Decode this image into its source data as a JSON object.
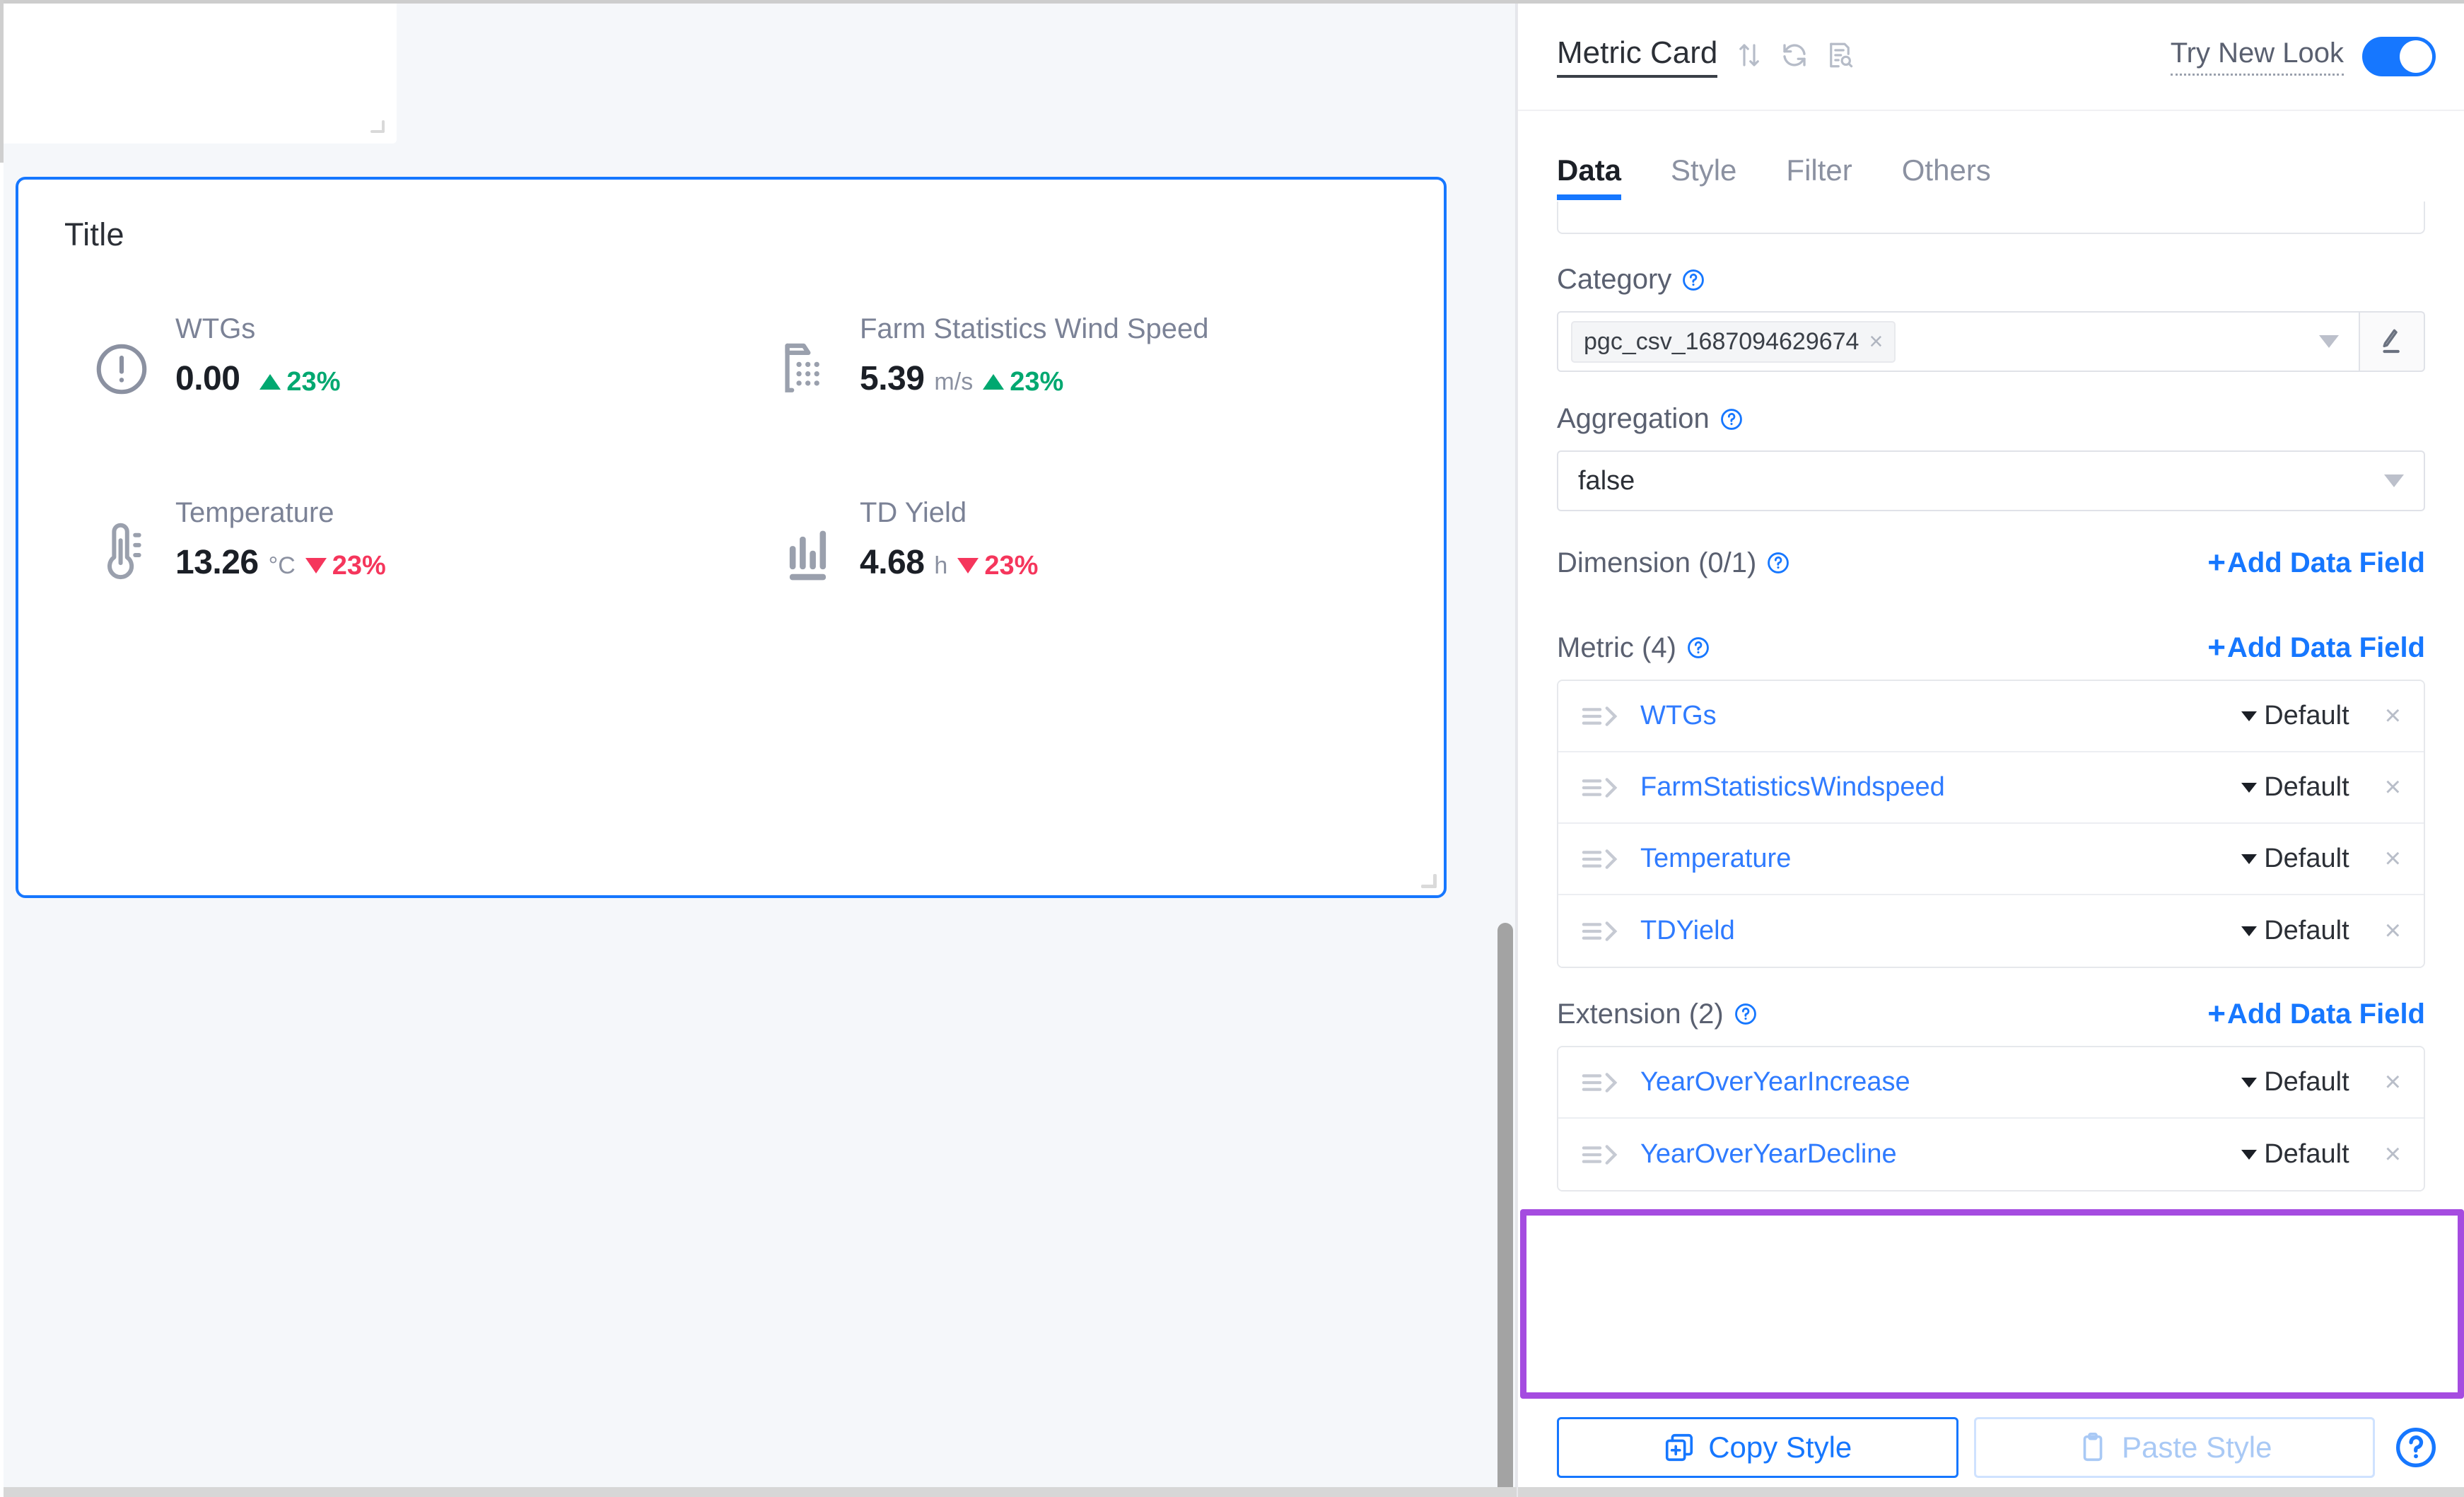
{
  "canvas": {
    "widget": {
      "title": "Title",
      "metrics": [
        {
          "icon": "alert-circle-icon",
          "label": "WTGs",
          "value": "0.00",
          "unit": "",
          "delta": "23%",
          "direction": "up"
        },
        {
          "icon": "data-file-icon",
          "label": "Farm Statistics Wind Speed",
          "value": "5.39",
          "unit": "m/s",
          "delta": "23%",
          "direction": "up"
        },
        {
          "icon": "thermometer-icon",
          "label": "Temperature",
          "value": "13.26",
          "unit": "°C",
          "delta": "23%",
          "direction": "down"
        },
        {
          "icon": "bar-chart-icon",
          "label": "TD Yield",
          "value": "4.68",
          "unit": "h",
          "delta": "23%",
          "direction": "down"
        }
      ]
    }
  },
  "panel": {
    "chart_type": "Metric Card",
    "header_icons": [
      "sort-icon",
      "refresh-icon",
      "inspect-data-icon"
    ],
    "try_new_look_label": "Try New Look",
    "try_new_look_enabled": true,
    "tabs": [
      {
        "label": "Data",
        "active": true
      },
      {
        "label": "Style",
        "active": false
      },
      {
        "label": "Filter",
        "active": false
      },
      {
        "label": "Others",
        "active": false
      }
    ],
    "category": {
      "label": "Category",
      "chip": "pgc_csv_1687094629674",
      "chip_remove": "×"
    },
    "aggregation": {
      "label": "Aggregation",
      "value": "false"
    },
    "dimension": {
      "label": "Dimension (0/1)",
      "add_label": "Add Data Field",
      "items": []
    },
    "metric": {
      "label": "Metric (4)",
      "add_label": "Add Data Field",
      "items": [
        {
          "name": "WTGs",
          "agg": "Default",
          "remove": "×"
        },
        {
          "name": "FarmStatisticsWindspeed",
          "agg": "Default",
          "remove": "×"
        },
        {
          "name": "Temperature",
          "agg": "Default",
          "remove": "×"
        },
        {
          "name": "TDYield",
          "agg": "Default",
          "remove": "×"
        }
      ]
    },
    "extension": {
      "label": "Extension (2)",
      "add_label": "Add Data Field",
      "items": [
        {
          "name": "YearOverYearIncrease",
          "agg": "Default",
          "remove": "×"
        },
        {
          "name": "YearOverYearDecline",
          "agg": "Default",
          "remove": "×"
        }
      ]
    },
    "footer": {
      "copy_label": "Copy Style",
      "paste_label": "Paste Style"
    }
  },
  "colors": {
    "accent_blue": "#1677ff",
    "link_blue": "#2f7bff",
    "up_green": "#00a870",
    "down_red": "#f5365c",
    "highlight_purple": "#a54ce0"
  }
}
